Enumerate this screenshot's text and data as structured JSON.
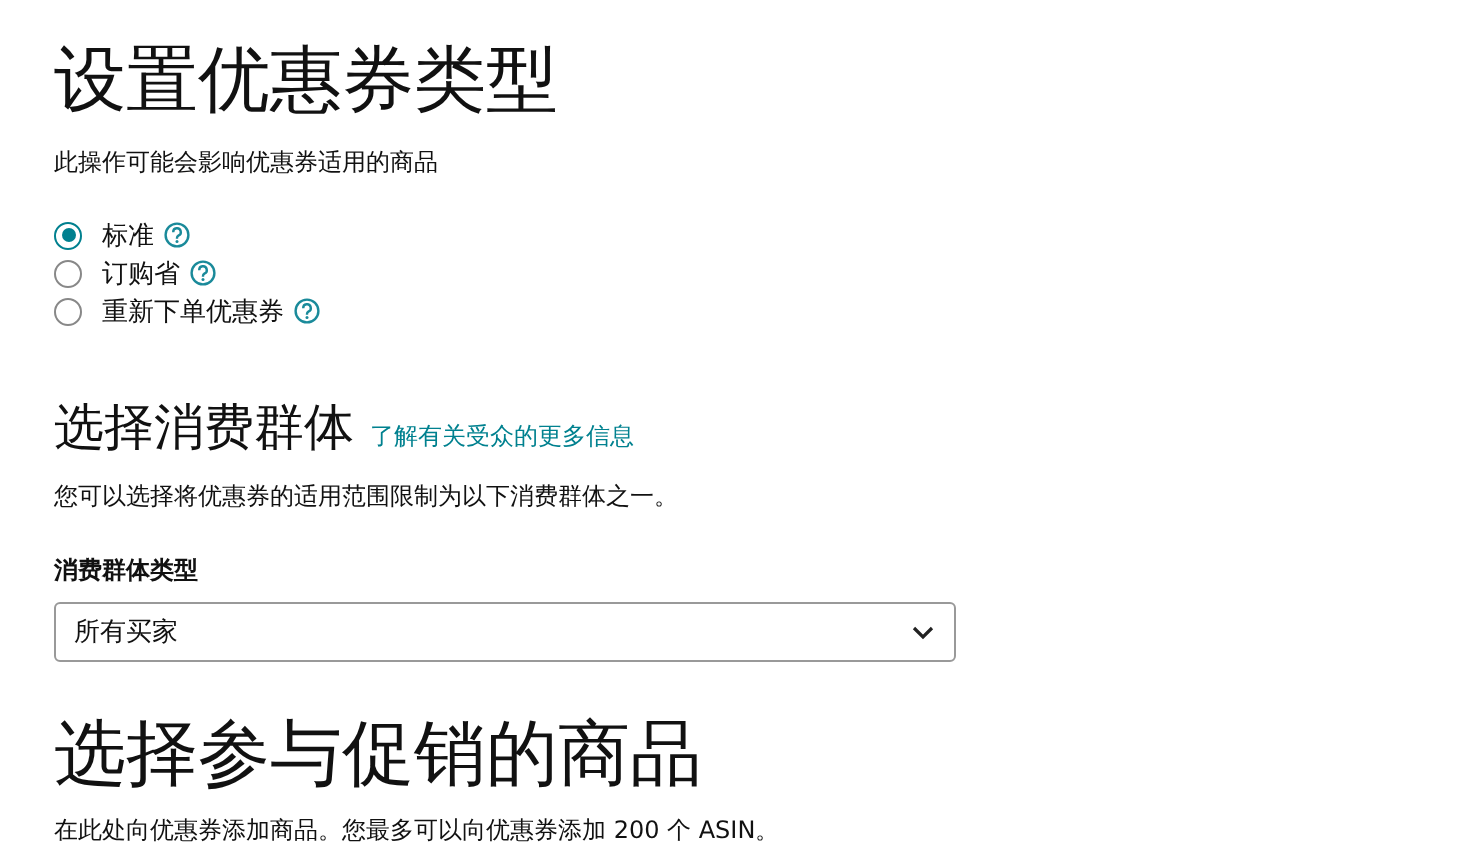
{
  "title": "设置优惠券类型",
  "subtitle": "此操作可能会影响优惠券适用的商品",
  "coupon_types": [
    {
      "label": "标准",
      "selected": true
    },
    {
      "label": "订购省",
      "selected": false
    },
    {
      "label": "重新下单优惠券",
      "selected": false
    }
  ],
  "audience": {
    "heading": "选择消费群体",
    "link": "了解有关受众的更多信息",
    "description": "您可以选择将优惠券的适用范围限制为以下消费群体之一。",
    "field_label": "消费群体类型",
    "value": "所有买家"
  },
  "products": {
    "heading": "选择参与促销的商品",
    "description": "在此处向优惠券添加商品。您最多可以向优惠券添加 200 个 ASIN。"
  }
}
